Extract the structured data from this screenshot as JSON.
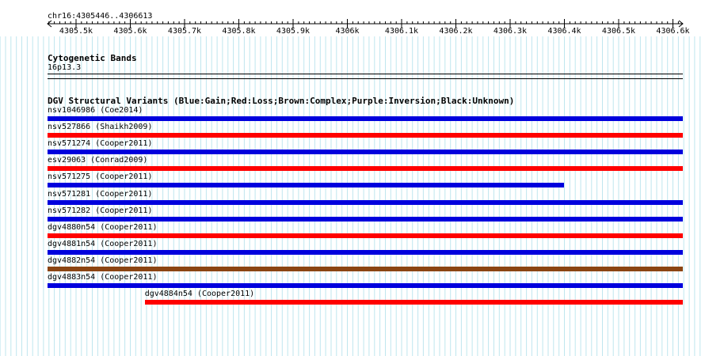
{
  "ruler": {
    "coordinates": "chr16:4305446..4306613",
    "ticks": [
      "4305.5k",
      "4305.6k",
      "4305.7k",
      "4305.8k",
      "4305.9k",
      "4306k",
      "4306.1k",
      "4306.2k",
      "4306.3k",
      "4306.4k",
      "4306.5k",
      "4306.6k"
    ]
  },
  "cytoband": {
    "title": "Cytogenetic Bands",
    "band": "16p13.3"
  },
  "dgv": {
    "title": "DGV Structural Variants (Blue:Gain;Red:Loss;Brown:Complex;Purple:Inversion;Black:Unknown)",
    "colors": {
      "gain": "#0000dd",
      "loss": "#ff0000",
      "complex": "#8b4513"
    },
    "variants": [
      {
        "label": "nsv1046986 (Coe2014)",
        "type": "gain",
        "start_frac": 0.0,
        "end_frac": 1.0
      },
      {
        "label": "nsv527866 (Shaikh2009)",
        "type": "loss",
        "start_frac": 0.0,
        "end_frac": 1.0
      },
      {
        "label": "nsv571274 (Cooper2011)",
        "type": "gain",
        "start_frac": 0.0,
        "end_frac": 1.0
      },
      {
        "label": "esv29063 (Conrad2009)",
        "type": "loss",
        "start_frac": 0.0,
        "end_frac": 1.0
      },
      {
        "label": "nsv571275 (Cooper2011)",
        "type": "gain",
        "start_frac": 0.0,
        "end_frac": 0.813
      },
      {
        "label": "nsv571281 (Cooper2011)",
        "type": "gain",
        "start_frac": 0.0,
        "end_frac": 1.0
      },
      {
        "label": "nsv571282 (Cooper2011)",
        "type": "gain",
        "start_frac": 0.0,
        "end_frac": 1.0
      },
      {
        "label": "dgv4880n54 (Cooper2011)",
        "type": "loss",
        "start_frac": 0.0,
        "end_frac": 1.0
      },
      {
        "label": "dgv4881n54 (Cooper2011)",
        "type": "gain",
        "start_frac": 0.0,
        "end_frac": 1.0
      },
      {
        "label": "dgv4882n54 (Cooper2011)",
        "type": "complex",
        "start_frac": 0.0,
        "end_frac": 1.0
      },
      {
        "label": "dgv4883n54 (Cooper2011)",
        "type": "gain",
        "start_frac": 0.0,
        "end_frac": 1.0
      },
      {
        "label": "dgv4884n54 (Cooper2011)",
        "type": "loss",
        "start_frac": 0.153,
        "end_frac": 1.0
      }
    ]
  }
}
